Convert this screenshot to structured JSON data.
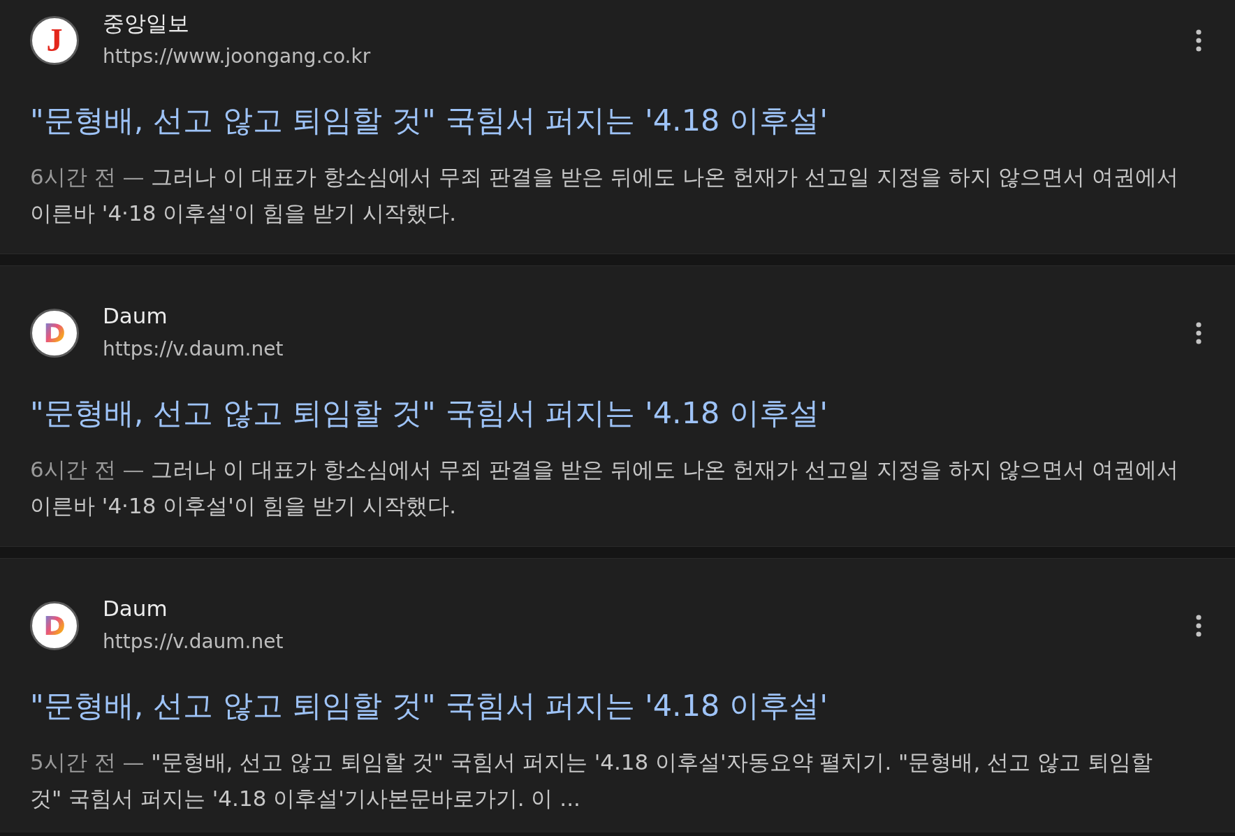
{
  "results": [
    {
      "source": "중앙일보",
      "url": "https://www.joongang.co.kr",
      "logo": {
        "kind": "serif-letter",
        "text": "J"
      },
      "title": "\"문형배, 선고 않고 퇴임할 것\" 국힘서 퍼지는 '4.18 이후설'",
      "age": "6시간 전 —",
      "snippet": "그러나 이 대표가 항소심에서 무죄 판결을 받은 뒤에도 나온 헌재가 선고일 지정을 하지 않으면서 여권에서 이른바 '4·18 이후설'이 힘을 받기 시작했다."
    },
    {
      "source": "Daum",
      "url": "https://v.daum.net",
      "logo": {
        "kind": "gradient-letter",
        "text": "D"
      },
      "title": "\"문형배, 선고 않고 퇴임할 것\" 국힘서 퍼지는 '4.18 이후설'",
      "age": "6시간 전 —",
      "snippet": "그러나 이 대표가 항소심에서 무죄 판결을 받은 뒤에도 나온 헌재가 선고일 지정을 하지 않으면서 여권에서 이른바 '4·18 이후설'이 힘을 받기 시작했다."
    },
    {
      "source": "Daum",
      "url": "https://v.daum.net",
      "logo": {
        "kind": "gradient-letter",
        "text": "D"
      },
      "title": "\"문형배, 선고 않고 퇴임할 것\" 국힘서 퍼지는 '4.18 이후설'",
      "age": "5시간 전 —",
      "snippet": "\"문형배, 선고 않고 퇴임할 것\" 국힘서 퍼지는 '4.18 이후설'자동요약 펼치기. \"문형배, 선고 않고 퇴임할 것\" 국힘서 퍼지는 '4.18 이후설'기사본문바로가기. 이 ..."
    }
  ]
}
